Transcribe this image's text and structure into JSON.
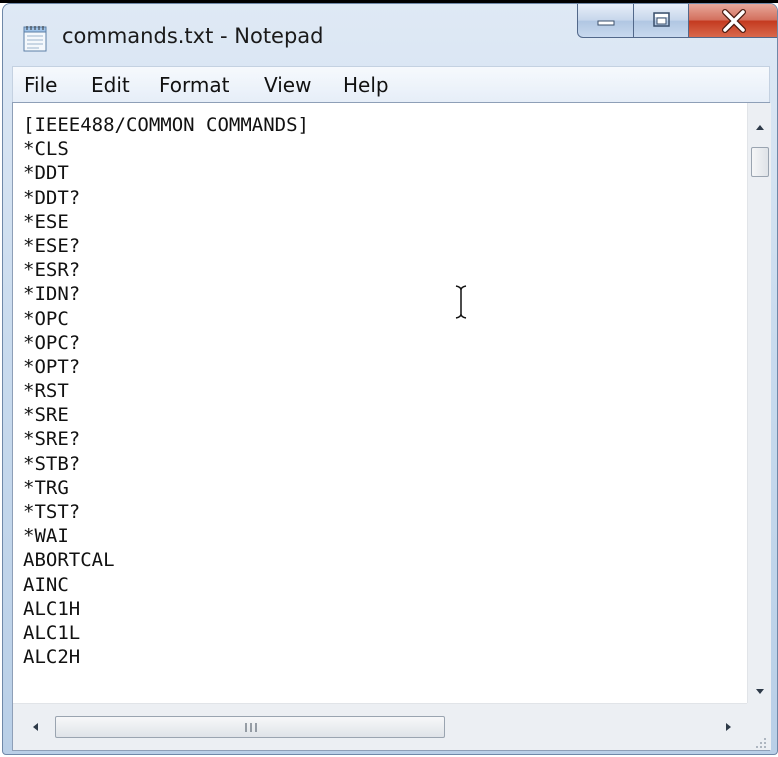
{
  "window": {
    "title": "commands.txt - Notepad"
  },
  "menu": {
    "items": [
      "File",
      "Edit",
      "Format",
      "View",
      "Help"
    ]
  },
  "editor": {
    "lines": [
      "[IEEE488/COMMON COMMANDS]",
      "*CLS",
      "*DDT",
      "*DDT?",
      "*ESE",
      "*ESE?",
      "*ESR?",
      "*IDN?",
      "*OPC",
      "*OPC?",
      "*OPT?",
      "*RST",
      "*SRE",
      "*SRE?",
      "*STB?",
      "*TRG",
      "*TST?",
      "*WAI",
      "ABORTCAL",
      "AINC",
      "ALC1H",
      "ALC1L",
      "ALC2H"
    ]
  },
  "icons": {
    "app": "notepad-icon",
    "minimize": "minimize-icon",
    "maximize": "maximize-icon",
    "close": "close-icon",
    "cursor": "text-cursor-icon"
  },
  "colors": {
    "close_button": "#c43a20",
    "window_frame": "#c9dbee",
    "text": "#111111"
  }
}
